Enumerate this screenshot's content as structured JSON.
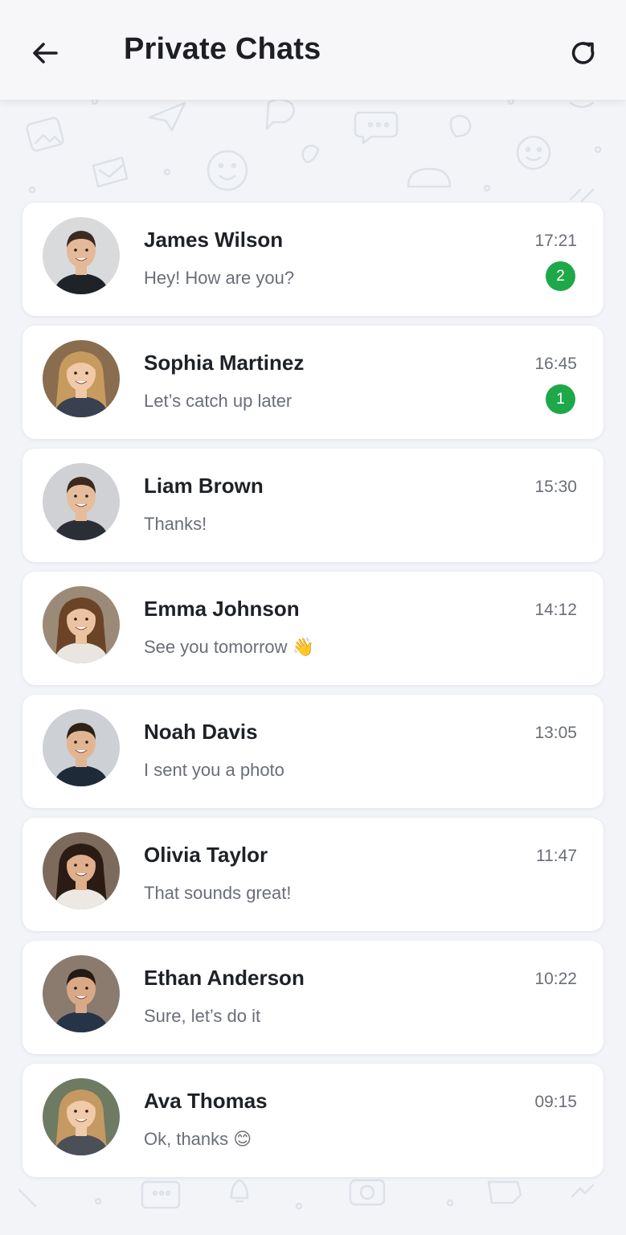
{
  "header": {
    "title": "Private Chats",
    "back_icon": "arrow-left-icon",
    "refresh_icon": "refresh-icon"
  },
  "colors": {
    "badge": "#1fa84a",
    "background": "#f2f4f8",
    "card": "#ffffff"
  },
  "chats": [
    {
      "name": "James Wilson",
      "message": "Hey! How are you?",
      "time": "17:21",
      "unread": "2",
      "skin": "#e3b998",
      "hair": "#3a2a20",
      "shirt": "#1f2328",
      "bg": "#d9dadc",
      "long_hair": false
    },
    {
      "name": "Sophia Martinez",
      "message": "Let’s catch up later",
      "time": "16:45",
      "unread": "1",
      "skin": "#f0c9a8",
      "hair": "#c79a5e",
      "shirt": "#394150",
      "bg": "#8a6c4e",
      "long_hair": true
    },
    {
      "name": "Liam Brown",
      "message": "Thanks!",
      "time": "15:30",
      "unread": "",
      "skin": "#e6bd9c",
      "hair": "#3b2a1f",
      "shirt": "#2b2f35",
      "bg": "#cfd1d4",
      "long_hair": false
    },
    {
      "name": "Emma Johnson",
      "message": "See you tomorrow",
      "message_emoji": "👋",
      "time": "14:12",
      "unread": "",
      "skin": "#ecc3a2",
      "hair": "#6b4427",
      "shirt": "#e9e6e2",
      "bg": "#9c8a78",
      "long_hair": true
    },
    {
      "name": "Noah Davis",
      "message": "I sent you a photo",
      "time": "13:05",
      "unread": "",
      "skin": "#e2b592",
      "hair": "#2e2118",
      "shirt": "#1f2a38",
      "bg": "#cdd0d4",
      "long_hair": false
    },
    {
      "name": "Olivia Taylor",
      "message": "That sounds great!",
      "time": "11:47",
      "unread": "",
      "skin": "#dfae8c",
      "hair": "#2a1c14",
      "shirt": "#ece9e4",
      "bg": "#7c6a5c",
      "long_hair": true
    },
    {
      "name": "Ethan Anderson",
      "message": "Sure, let’s do it",
      "time": "10:22",
      "unread": "",
      "skin": "#d9a886",
      "hair": "#241913",
      "shirt": "#263448",
      "bg": "#8a7b6e",
      "long_hair": false
    },
    {
      "name": "Ava Thomas",
      "message": "Ok, thanks",
      "message_emoji": "😊",
      "time": "09:15",
      "unread": "",
      "skin": "#f0caa9",
      "hair": "#c49a62",
      "shirt": "#4a4f58",
      "bg": "#6f7a62",
      "long_hair": true
    }
  ]
}
